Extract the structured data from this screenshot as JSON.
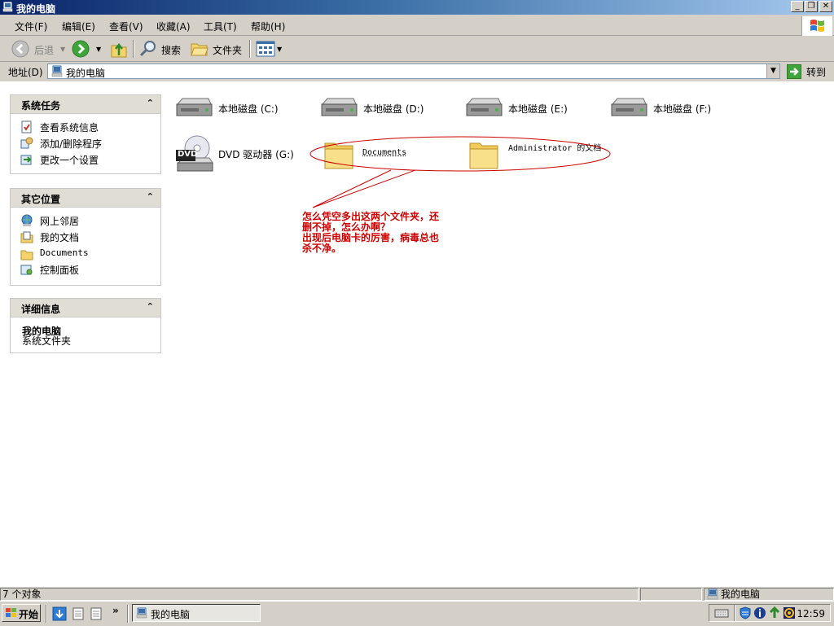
{
  "window": {
    "title": "我的电脑",
    "controls": {
      "minimize": "_",
      "maximize": "❐",
      "close": "✕"
    }
  },
  "menu": [
    "文件(F)",
    "编辑(E)",
    "查看(V)",
    "收藏(A)",
    "工具(T)",
    "帮助(H)"
  ],
  "toolbar": {
    "back_label": "后退",
    "search_label": "搜索",
    "folders_label": "文件夹"
  },
  "address": {
    "label": "地址(D)",
    "value": "我的电脑",
    "go_label": "转到"
  },
  "sidebar": {
    "system_tasks": {
      "title": "系统任务",
      "items": [
        "查看系统信息",
        "添加/删除程序",
        "更改一个设置"
      ]
    },
    "other_places": {
      "title": "其它位置",
      "items": [
        "网上邻居",
        "我的文档",
        "Documents",
        "控制面板"
      ]
    },
    "details": {
      "title": "详细信息",
      "name": "我的电脑",
      "type": "系统文件夹"
    }
  },
  "content": {
    "drives": [
      {
        "label": "本地磁盘 (C:)",
        "icon": "hard-drive-icon"
      },
      {
        "label": "本地磁盘 (D:)",
        "icon": "hard-drive-icon"
      },
      {
        "label": "本地磁盘 (E:)",
        "icon": "hard-drive-icon"
      },
      {
        "label": "本地磁盘 (F:)",
        "icon": "hard-drive-icon"
      },
      {
        "label": "DVD 驱动器 (G:)",
        "icon": "dvd-drive-icon"
      }
    ],
    "folders": [
      {
        "label": "Documents",
        "icon": "folder-icon"
      },
      {
        "label": "Administrator 的文档",
        "icon": "folder-icon"
      }
    ],
    "dvd_badge": "DVD",
    "annotation": [
      "怎么凭空多出这两个文件夹，还",
      "删不掉，怎么办啊？",
      "出现后电脑卡的厉害，病毒总也",
      "杀不净。"
    ]
  },
  "statusbar": {
    "count": "7 个对象",
    "location": "我的电脑"
  },
  "taskbar": {
    "start_label": "开始",
    "window_label": "我的电脑",
    "clock": "12:59"
  },
  "colors": {
    "title_gradient_start": "#0a246a",
    "title_gradient_end": "#a6caf0",
    "annotation": "#cc0000",
    "panel_header": "#e0ddd4"
  }
}
